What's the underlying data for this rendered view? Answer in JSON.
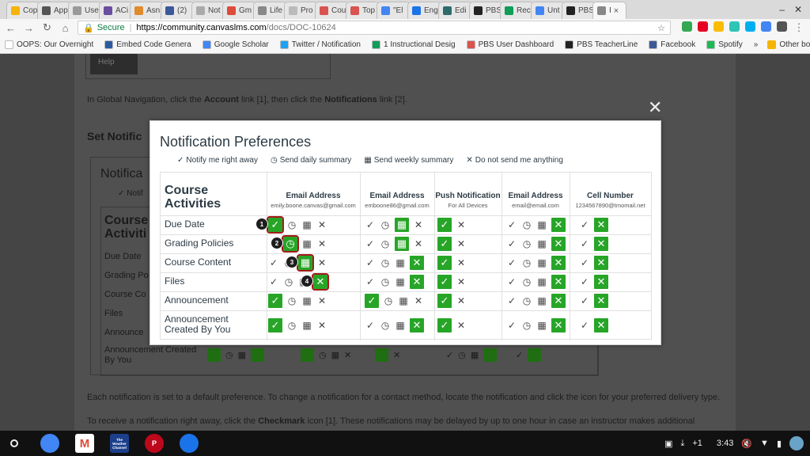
{
  "browser": {
    "tabs": [
      {
        "label": "Cop",
        "color": "#f4b400"
      },
      {
        "label": "App",
        "color": "#555555"
      },
      {
        "label": "Use",
        "color": "#999999"
      },
      {
        "label": "ACi",
        "color": "#6a4fa0"
      },
      {
        "label": "Asn",
        "color": "#e08a2e"
      },
      {
        "label": "(2)",
        "color": "#3b5998"
      },
      {
        "label": "Not",
        "color": "#aaaaaa"
      },
      {
        "label": "Gm",
        "color": "#dd4b39"
      },
      {
        "label": "Life",
        "color": "#888888"
      },
      {
        "label": "Pro",
        "color": "#bbbbbb"
      },
      {
        "label": "Cou",
        "color": "#d9534f"
      },
      {
        "label": "Top",
        "color": "#d9534f"
      },
      {
        "label": "\"El",
        "color": "#4285f4"
      },
      {
        "label": "Eng",
        "color": "#1a73e8"
      },
      {
        "label": "Edi",
        "color": "#2d6b6b"
      },
      {
        "label": "PBS",
        "color": "#222222"
      },
      {
        "label": "Rec",
        "color": "#0f9d58"
      },
      {
        "label": "Unt",
        "color": "#4285f4"
      },
      {
        "label": "PBS",
        "color": "#222222"
      },
      {
        "label": "I",
        "color": "#888888",
        "active": true
      }
    ],
    "window_controls": {
      "minimize": "–",
      "close": "✕"
    },
    "url": {
      "secure_label": "Secure",
      "host": "https://community.canvaslms.com",
      "path": "/docs/DOC-10624"
    },
    "bookmarks": [
      {
        "label": "OOPS: Our Overnight",
        "color": "#ffffff"
      },
      {
        "label": "Embed Code Genera",
        "color": "#2c5aa0"
      },
      {
        "label": "Google Scholar",
        "color": "#4285f4"
      },
      {
        "label": "Twitter / Notification",
        "color": "#1da1f2"
      },
      {
        "label": "1 Instructional Desig",
        "color": "#0f9d58"
      },
      {
        "label": "PBS User Dashboard",
        "color": "#d9534f"
      },
      {
        "label": "PBS TeacherLine",
        "color": "#222222"
      },
      {
        "label": "Facebook",
        "color": "#3b5998"
      },
      {
        "label": "Spotify",
        "color": "#1db954"
      }
    ],
    "bookmarks_more": "»",
    "other_bookmarks": "Other bookmarks"
  },
  "background": {
    "help_label": "Help",
    "instruction_prefix": "In Global Navigation, click the ",
    "instruction_account": "Account",
    "instruction_middle": " link [1], then click the ",
    "instruction_notifications": "Notifications",
    "instruction_suffix": " link [2].",
    "heading": "Set Notific",
    "panel_title": "Notifica",
    "panel_sub": "✓ Notif",
    "table_title": "Course Activiti",
    "rows": [
      "Due Date",
      "Grading Po",
      "Course Co",
      "Files",
      "Announce",
      "Announcement Created By You"
    ],
    "para1": "Each notification is set to a default preference. To change a notification for a contact method, locate the notification and click the icon for your preferred delivery type.",
    "para2_prefix": "To receive a notification right away, click the ",
    "para2_bold": "Checkmark",
    "para2_suffix": " icon [1]. These notifications may be delayed by up to one hour in case an instructor makes additional"
  },
  "modal": {
    "title": "Notification Preferences",
    "legend": [
      {
        "icon": "✓",
        "label": "Notify me right away"
      },
      {
        "icon": "◷",
        "label": "Send daily summary"
      },
      {
        "icon": "▦",
        "label": "Send weekly summary"
      },
      {
        "icon": "✕",
        "label": "Do not send me anything"
      }
    ],
    "section_title": "Course Activities",
    "columns": [
      {
        "label": "Email Address",
        "sub": "emily.boone.canvas@gmail.com"
      },
      {
        "label": "Email Address",
        "sub": "emboone86@gmail.com"
      },
      {
        "label": "Push Notification",
        "sub": "For All Devices"
      },
      {
        "label": "Email Address",
        "sub": "email@email.com"
      },
      {
        "label": "Cell Number",
        "sub": "1234567890@tmomail.net"
      }
    ],
    "rows": [
      {
        "label": "Due Date",
        "selected": [
          "check",
          "weekly",
          "check",
          "cross",
          "cross"
        ]
      },
      {
        "label": "Grading Policies",
        "selected": [
          "daily",
          "weekly",
          "check",
          "cross",
          "cross"
        ]
      },
      {
        "label": "Course Content",
        "selected": [
          "weekly",
          "cross",
          "check",
          "cross",
          "cross"
        ]
      },
      {
        "label": "Files",
        "selected": [
          "cross",
          "cross",
          "check",
          "cross",
          "cross"
        ]
      },
      {
        "label": "Announcement",
        "selected": [
          "check",
          "check",
          "check",
          "cross",
          "cross"
        ]
      },
      {
        "label": "Announcement Created By You",
        "selected": [
          "check",
          "cross",
          "check",
          "cross",
          "cross"
        ]
      }
    ],
    "callouts": [
      "1",
      "2",
      "3",
      "4"
    ],
    "close_icon": "✕"
  },
  "colors": {
    "selected_green": "#27a527",
    "callout_outline": "#a31b1b",
    "canvas_text": "#2d3b45"
  },
  "shelf": {
    "apps": [
      {
        "name": "chrome",
        "label": "",
        "color": "#4285f4"
      },
      {
        "name": "gmail",
        "label": "M",
        "color": "#dd4b39"
      },
      {
        "name": "weather",
        "label": "The Weather Channel",
        "color": "#1b3f8b"
      },
      {
        "name": "pinterest",
        "label": "P",
        "color": "#bd081c"
      },
      {
        "name": "files",
        "label": "",
        "color": "#1a73e8"
      }
    ],
    "tray": {
      "notifications": "+1",
      "time": "3:43"
    }
  }
}
